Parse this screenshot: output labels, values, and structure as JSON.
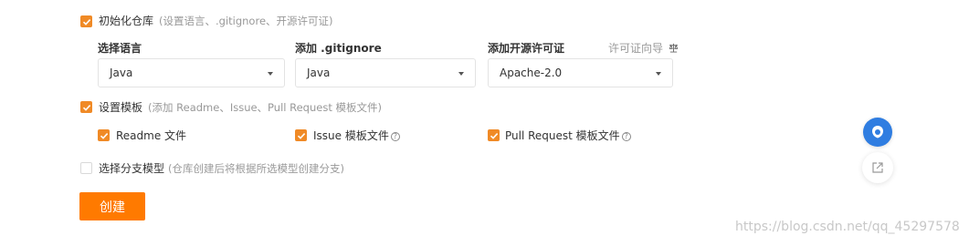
{
  "init_repo": {
    "label": "初始化仓库",
    "hint": "(设置语言、.gitignore、开源许可证)",
    "checked": true,
    "fields": {
      "language": {
        "title": "选择语言",
        "value": "Java"
      },
      "gitignore": {
        "title": "添加 .gitignore",
        "value": "Java"
      },
      "license": {
        "title": "添加开源许可证",
        "value": "Apache-2.0",
        "guide_label": "许可证向导"
      }
    }
  },
  "template": {
    "label": "设置模板",
    "hint": "(添加 Readme、Issue、Pull Request 模板文件)",
    "checked": true,
    "options": [
      {
        "label": "Readme 文件",
        "checked": true
      },
      {
        "label": "Issue 模板文件",
        "checked": true,
        "help": "?"
      },
      {
        "label": "Pull Request 模板文件",
        "checked": true,
        "help": "?"
      }
    ]
  },
  "branch_model": {
    "label": "选择分支模型",
    "hint": "(仓库创建后将根据所选模型创建分支)",
    "checked": false
  },
  "create_button": "创建",
  "watermark": "https://blog.csdn.net/qq_45297578",
  "colors": {
    "accent": "#f08a26",
    "button": "#ff7a00",
    "float_blue": "#2f7de1"
  },
  "icons": {
    "guide": "scale-icon",
    "float_primary": "chat-icon",
    "float_secondary": "share-icon"
  }
}
